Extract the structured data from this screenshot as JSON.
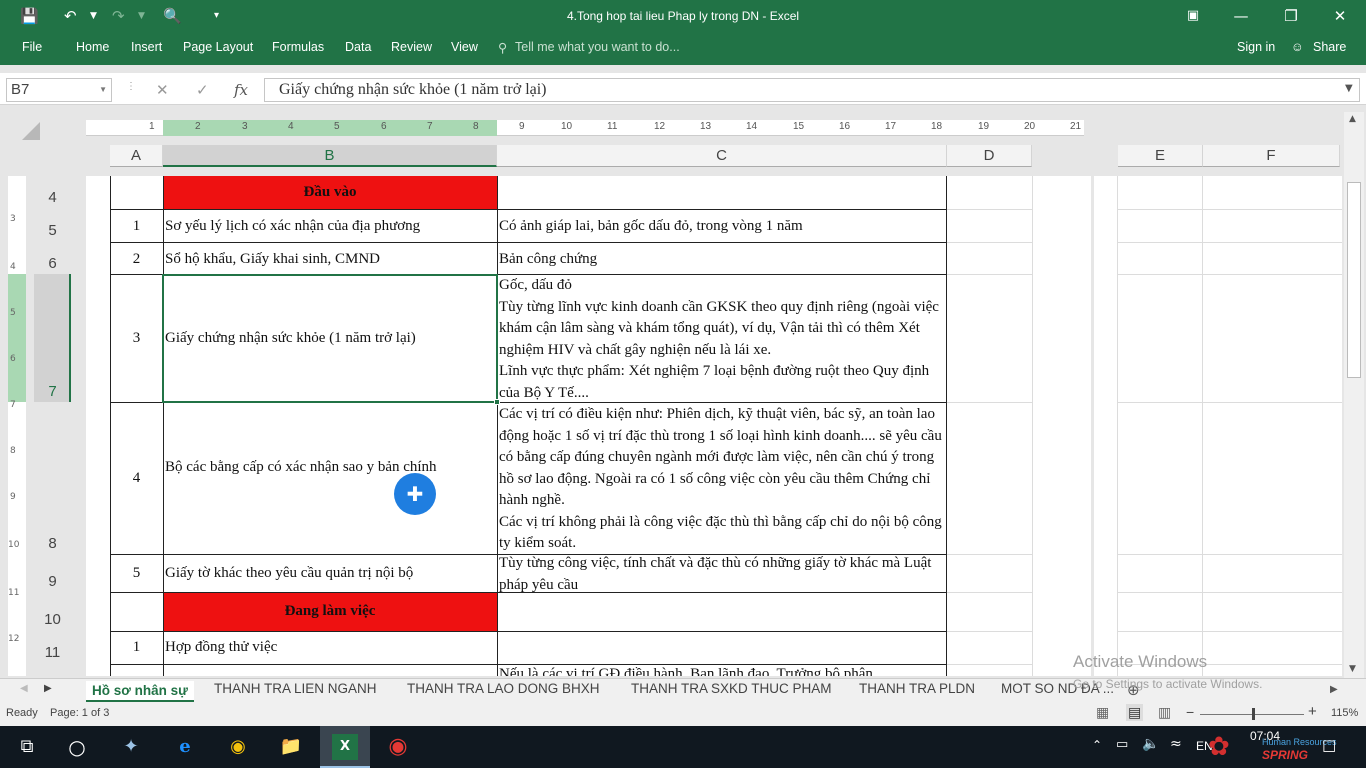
{
  "window": {
    "title": "4.Tong hop tai lieu Phap ly trong DN - Excel"
  },
  "ribbon": {
    "tabs": [
      "File",
      "Home",
      "Insert",
      "Page Layout",
      "Formulas",
      "Data",
      "Review",
      "View"
    ],
    "tell_me": "Tell me what you want to do...",
    "sign_in": "Sign in",
    "share": "Share"
  },
  "formula_bar": {
    "name_box": "B7",
    "cancel": "✕",
    "enter": "✓",
    "fx": "fx",
    "content": "Giấy chứng nhận sức khỏe (1 năm trở lại)"
  },
  "ruler": {
    "numbers": [
      "1",
      "2",
      "3",
      "4",
      "5",
      "6",
      "7",
      "8",
      "9",
      "10",
      "11",
      "12",
      "13",
      "14",
      "15",
      "16",
      "17",
      "18",
      "19",
      "20",
      "21"
    ]
  },
  "columns": [
    "A",
    "B",
    "C",
    "D",
    "E",
    "F"
  ],
  "rows": [
    "4",
    "5",
    "6",
    "7",
    "8",
    "9",
    "10",
    "11"
  ],
  "vruler": [
    "3",
    "4",
    "5",
    "6",
    "7",
    "8",
    "9",
    "10",
    "11",
    "12"
  ],
  "sheet": {
    "header_input": "Đầu vào",
    "header_working": "Đang làm việc",
    "r5": {
      "no": "1",
      "name": "Sơ yếu lý lịch có xác nhận của địa phương",
      "note": "Có ảnh giáp lai, bản gốc dấu đỏ, trong vòng 1 năm"
    },
    "r6": {
      "no": "2",
      "name": "Sổ hộ khẩu, Giấy khai sinh, CMND",
      "note": "Bản công chứng"
    },
    "r7": {
      "no": "3",
      "name": "Giấy chứng nhận sức khỏe (1 năm trở lại)",
      "note": "Gốc, dấu đỏ\nTùy từng lĩnh vực kinh doanh cần GKSK theo quy định riêng (ngoài việc khám cận lâm sàng và khám tổng quát), ví dụ, Vận tải thì có thêm Xét nghiệm HIV và chất gây nghiện nếu là lái xe.\nLĩnh vực thực phẩm: Xét nghiệm 7 loại bệnh đường ruột theo Quy định của Bộ Y Tế...."
    },
    "r8": {
      "no": "4",
      "name": "Bộ các bằng cấp có xác nhận sao y bản chính",
      "note": "Các vị trí có điều kiện như: Phiên dịch, kỹ thuật viên, bác sỹ, an toàn lao động hoặc 1 số vị trí đặc thù trong 1 số loại hình kinh doanh.... sẽ yêu cầu có bằng cấp đúng chuyên ngành mới được làm việc, nên cần chú ý trong hồ sơ lao động. Ngoài ra có 1 số công việc còn yêu cầu thêm Chứng chỉ hành nghề.\nCác vị trí không phải là công việc đặc thù thì bằng cấp chỉ do nội bộ công ty kiểm soát."
    },
    "r9": {
      "no": "5",
      "name": "Giấy tờ khác theo yêu cầu quản trị nội bộ",
      "note": "Tùy từng công việc, tính chất và đặc thù có những giấy tờ khác mà Luật pháp yêu cầu"
    },
    "r11": {
      "no": "1",
      "name": "Hợp đồng thử việc"
    },
    "r12_note": "Nếu là các vị trí GĐ điều hành, Ban lãnh đạo, Trưởng bộ phận"
  },
  "watermark": {
    "line1": "Activate Windows",
    "line2": "Go to Settings to activate Windows."
  },
  "sheet_tabs": [
    "Hồ sơ nhân sự",
    "THANH TRA LIEN NGANH",
    "THANH TRA LAO DONG BHXH",
    "THANH TRA SXKD THUC PHAM",
    "THANH TRA PLDN",
    "MOT SO ND ĐA ..."
  ],
  "status": {
    "ready": "Ready",
    "page": "Page: 1 of 3",
    "zoom": "115%"
  },
  "taskbar": {
    "time": "07:04",
    "lang": "EN",
    "brand": "Human Resources",
    "brand2": "SPRING"
  },
  "colors": {
    "excel_green": "#217346",
    "header_red": "#ee1111"
  }
}
